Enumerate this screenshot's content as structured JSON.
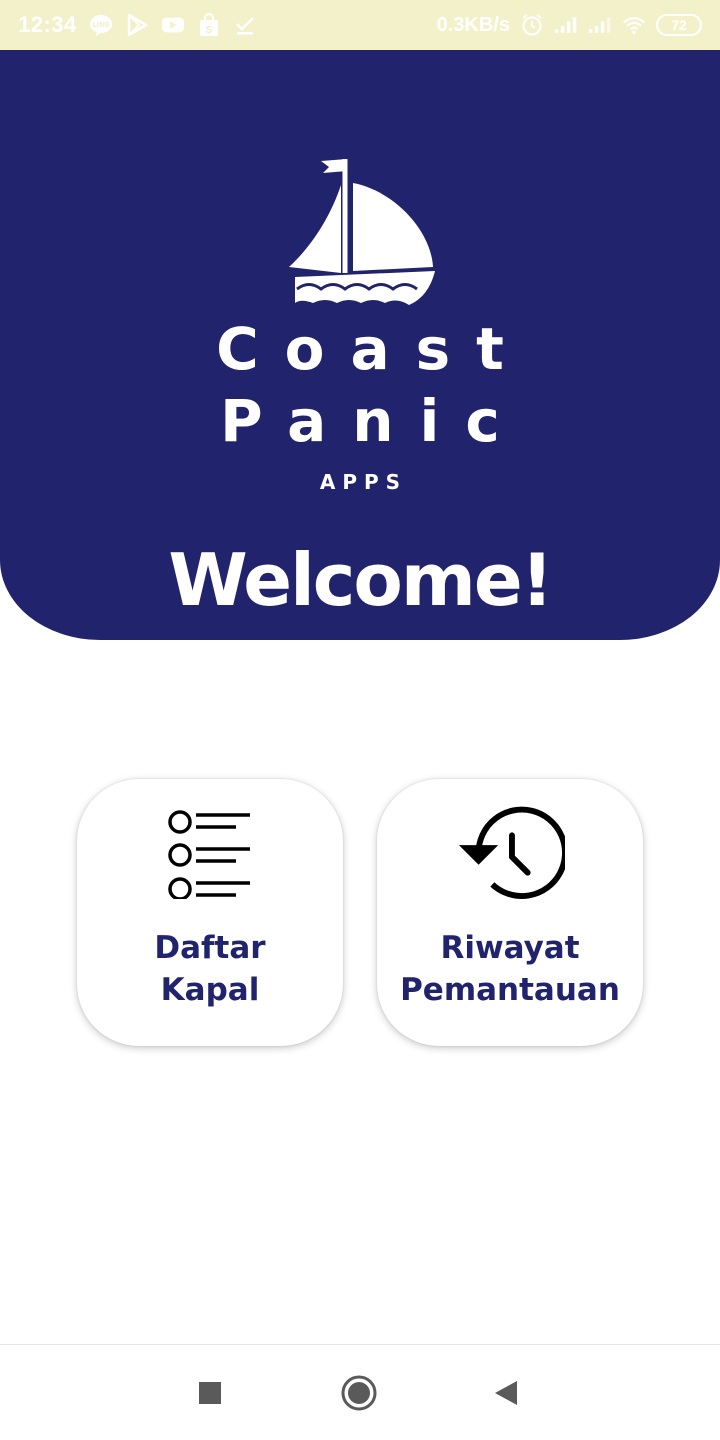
{
  "status_bar": {
    "time": "12:34",
    "net_speed": "0.3KB/s",
    "battery": "72",
    "left_icons": [
      "line-icon",
      "play-store-icon",
      "youtube-icon",
      "shopping-bag-icon",
      "download-done-icon"
    ],
    "right_icons": [
      "alarm-icon",
      "signal-icon",
      "signal-icon",
      "wifi-icon"
    ]
  },
  "header": {
    "logo_line1": "Coast",
    "logo_line2": "Panic",
    "logo_sub": "APPS",
    "welcome": "Welcome!",
    "background_color": "#21246d"
  },
  "menu": {
    "items": [
      {
        "label": "Daftar\nKapal",
        "icon": "list-icon"
      },
      {
        "label": "Riwayat\nPemantauan",
        "icon": "history-icon"
      }
    ],
    "label_color": "#21246d"
  },
  "nav": {
    "buttons": [
      "recent-apps-icon",
      "home-icon",
      "back-icon"
    ]
  }
}
